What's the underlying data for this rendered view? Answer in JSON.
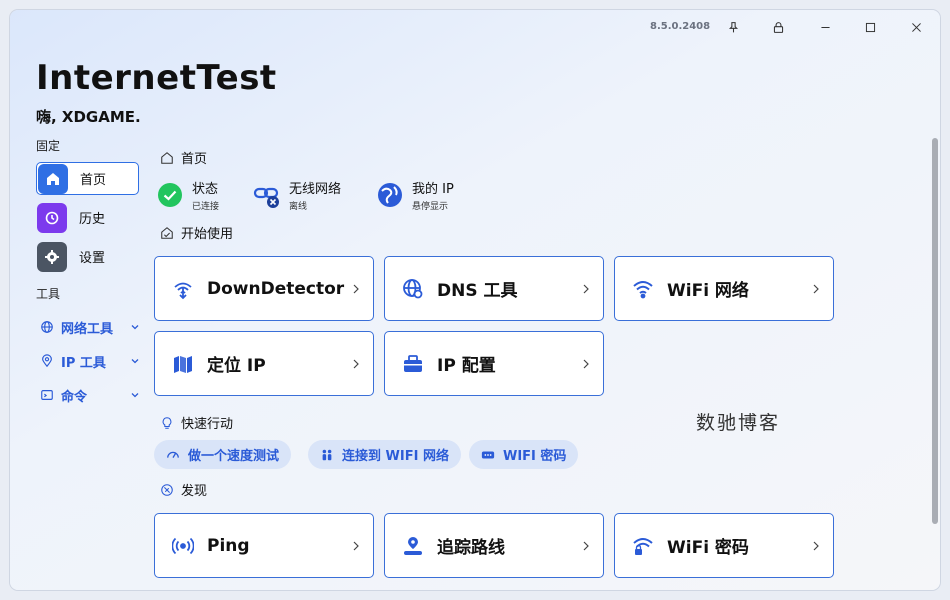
{
  "window": {
    "version": "8.5.0.2408",
    "controls": [
      "pin-icon",
      "lock-icon",
      "minimize-icon",
      "maximize-icon",
      "close-icon"
    ]
  },
  "app": {
    "title": "InternetTest",
    "greeting": "嗨, XDGAME."
  },
  "sidebar": {
    "pinned_label": "固定",
    "pinned": [
      {
        "label": "首页",
        "icon": "home-icon",
        "color": "#2f6fe4",
        "active": true
      },
      {
        "label": "历史",
        "icon": "history-icon",
        "color": "#7c3aed",
        "active": false
      },
      {
        "label": "设置",
        "icon": "gear-icon",
        "color": "#4b5563",
        "active": false
      }
    ],
    "tools_label": "工具",
    "tools": [
      {
        "label": "网络工具",
        "icon": "globe-icon"
      },
      {
        "label": "IP 工具",
        "icon": "location-pin-icon"
      },
      {
        "label": "命令",
        "icon": "terminal-icon"
      }
    ]
  },
  "main": {
    "home_header": "首页",
    "status": [
      {
        "title": "状态",
        "sub": "已连接",
        "icon": "check-circle-icon"
      },
      {
        "title": "无线网络",
        "sub": "离线",
        "icon": "link-off-icon"
      },
      {
        "title": "我的 IP",
        "sub": "悬停显示",
        "icon": "globe-person-icon"
      }
    ],
    "getting_started_header": "开始使用",
    "getting_started_cards": [
      {
        "label": "DownDetector",
        "icon": "signal-down-icon"
      },
      {
        "label": "DNS 工具",
        "icon": "dns-globe-icon"
      },
      {
        "label": "WiFi 网络",
        "icon": "wifi-icon"
      },
      {
        "label": "定位 IP",
        "icon": "map-icon"
      },
      {
        "label": "IP 配置",
        "icon": "toolbox-icon"
      }
    ],
    "quick_actions_header": "快速行动",
    "quick_actions": [
      {
        "label": "做一个速度测试",
        "icon": "speed-gauge-icon"
      },
      {
        "label": "连接到 WIFI 网络",
        "icon": "people-icon"
      },
      {
        "label": "WIFI 密码",
        "icon": "password-icon"
      }
    ],
    "discover_header": "发现",
    "discover_cards": [
      {
        "label": "Ping",
        "icon": "broadcast-icon"
      },
      {
        "label": "追踪路线",
        "icon": "route-pin-icon"
      },
      {
        "label": "WiFi 密码",
        "icon": "wifi-lock-icon"
      }
    ]
  },
  "watermark": "数驰博客",
  "colors": {
    "accent": "#2f6fe4",
    "link": "#2b5bd7",
    "pill_bg": "#d9e4f8",
    "success": "#22c55e"
  }
}
